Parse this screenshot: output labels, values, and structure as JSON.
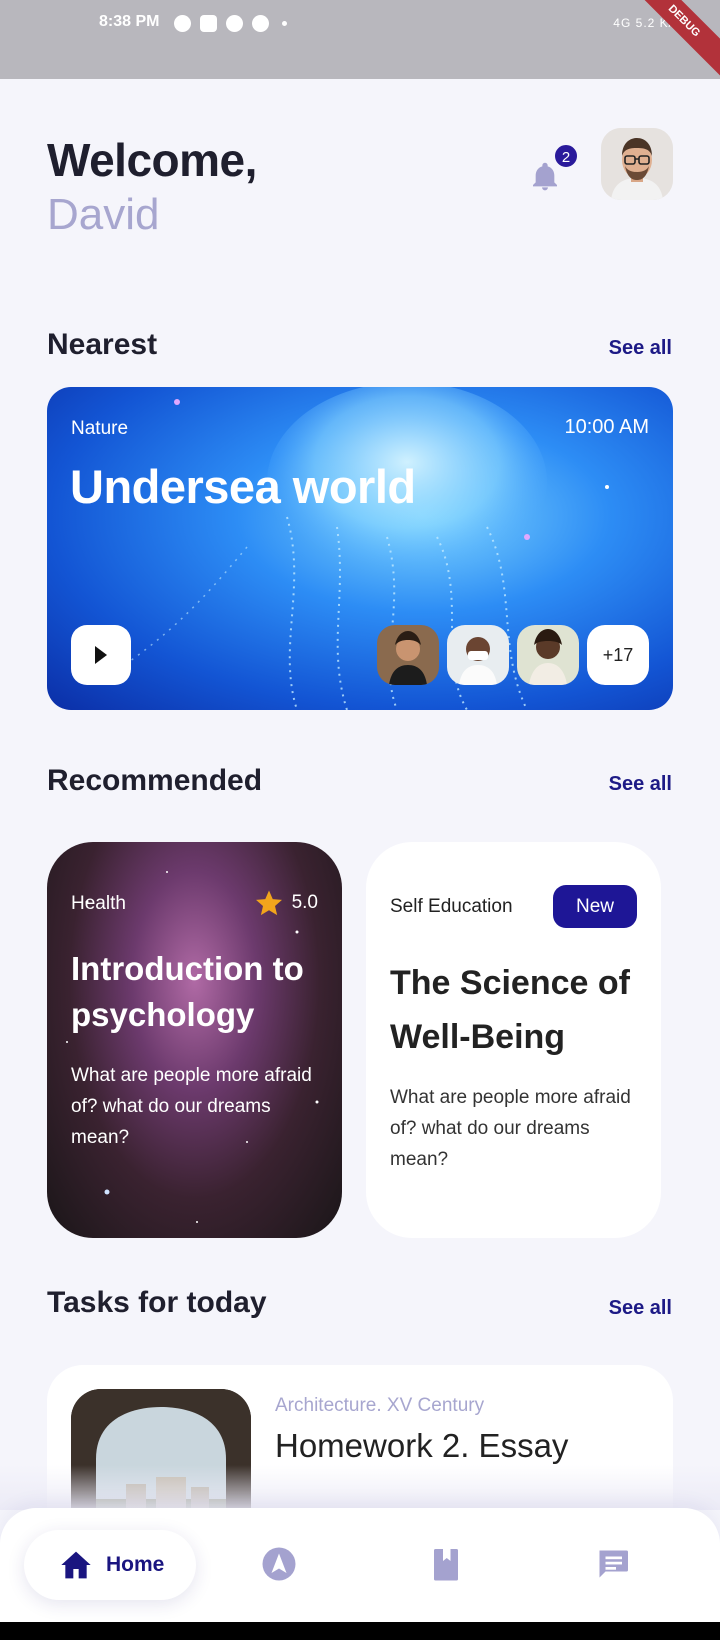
{
  "status_bar": {
    "time": "8:38 PM",
    "right_text": "4G 5.2 K/s",
    "debug_label": "DEBUG"
  },
  "header": {
    "greeting": "Welcome,",
    "user_name": "David",
    "notification_count": "2"
  },
  "nearest": {
    "section_title": "Nearest",
    "see_all": "See all",
    "card": {
      "category": "Nature",
      "time": "10:00 AM",
      "title": "Undersea world",
      "extra_participants": "+17"
    }
  },
  "recommended": {
    "section_title": "Recommended",
    "see_all": "See all",
    "cards": [
      {
        "category": "Health",
        "rating": "5.0",
        "title": "Introduction to psychology",
        "description": "What are people more afraid of? what do our dreams mean?"
      },
      {
        "category": "Self Education",
        "badge": "New",
        "title": "The Science of Well-Being",
        "description": "What are people more afraid of? what do our dreams mean?"
      }
    ]
  },
  "tasks": {
    "section_title": "Tasks for today",
    "see_all": "See all",
    "items": [
      {
        "subtitle": "Architecture. XV Century",
        "title": "Homework 2. Essay"
      }
    ]
  },
  "bottom_nav": {
    "items": [
      {
        "label": "Home",
        "icon": "home-icon",
        "active": true
      },
      {
        "label": "",
        "icon": "explore-icon"
      },
      {
        "label": "",
        "icon": "book-icon"
      },
      {
        "label": "",
        "icon": "chat-icon"
      }
    ]
  },
  "colors": {
    "accent": "#1e1696",
    "muted_text": "#a7a6cf",
    "background": "#f5f5fb"
  }
}
